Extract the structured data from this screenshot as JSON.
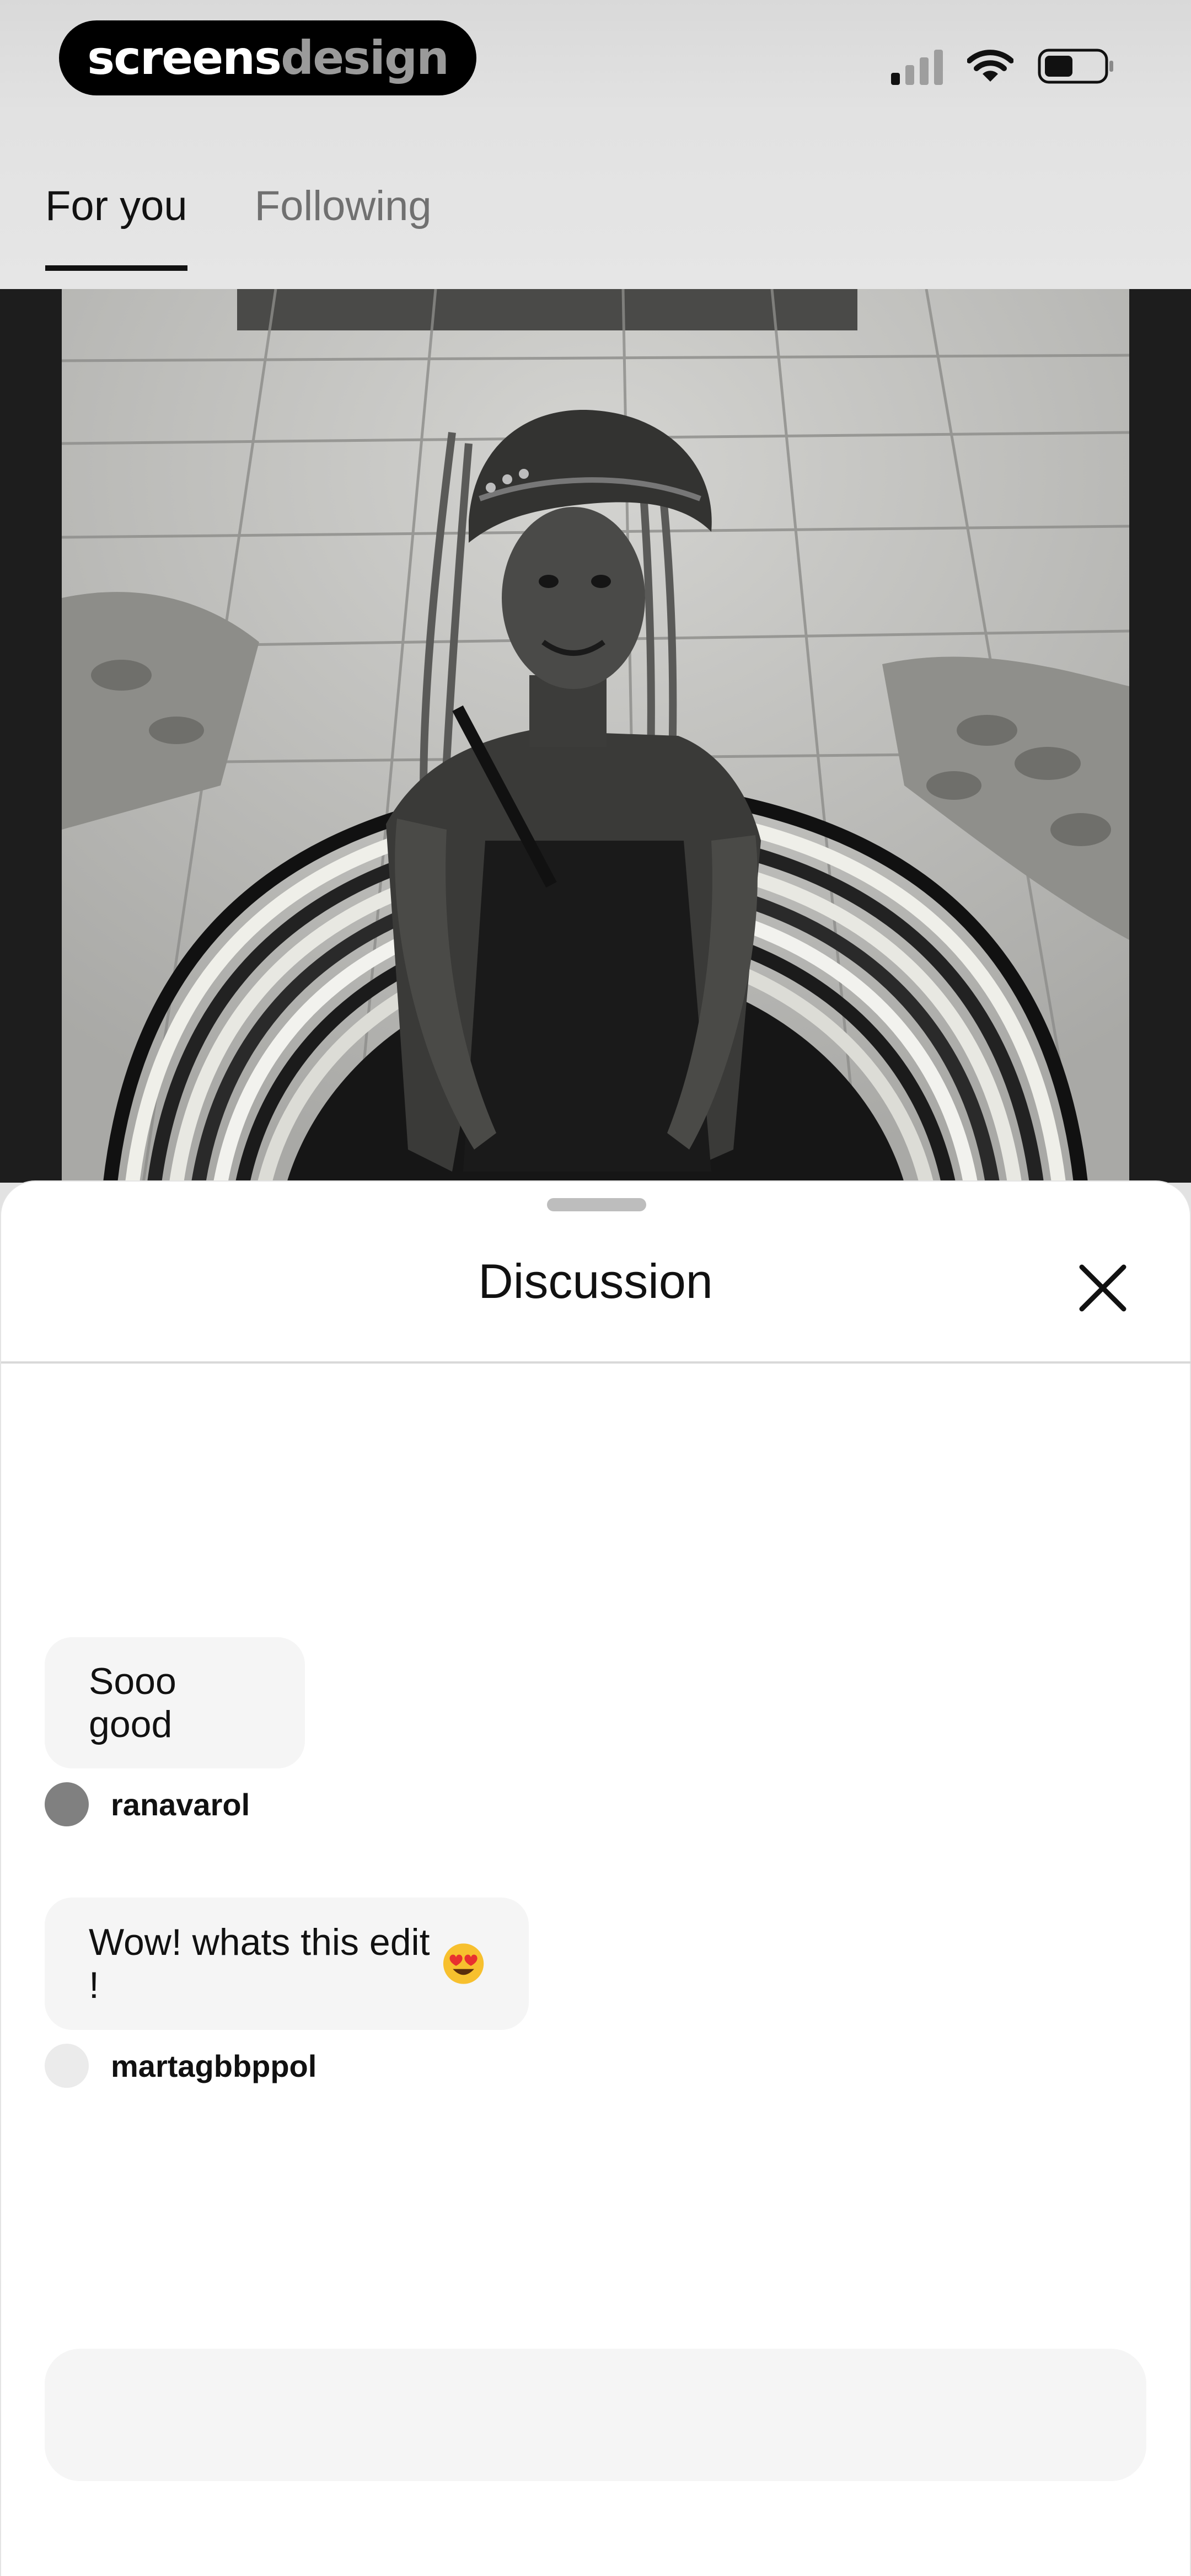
{
  "status_bar": {
    "brand_prefix": "screens",
    "brand_suffix": "design",
    "icons": [
      "cellular-signal-icon",
      "wifi-icon",
      "battery-icon"
    ]
  },
  "tabs": [
    {
      "label": "For you",
      "active": true
    },
    {
      "label": "Following",
      "active": false
    }
  ],
  "sheet": {
    "title": "Discussion",
    "comments": [
      {
        "text": "Sooo good",
        "author": "ranavarol",
        "avatar_color": "#808080"
      },
      {
        "text": "Wow! whats this edit !",
        "author": "martagbbppol",
        "avatar_color": "#ebebeb",
        "emoji": "heart-eyes-emoji"
      }
    ],
    "input": {
      "value": "",
      "placeholder": ""
    }
  },
  "colors": {
    "accent": "#111111",
    "bubble_bg": "#f5f5f5",
    "inactive_tab": "#707070"
  }
}
